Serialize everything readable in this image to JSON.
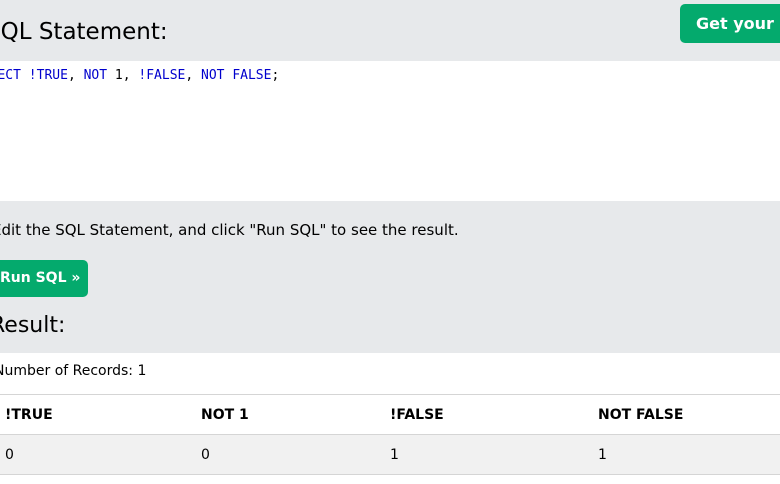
{
  "header": {
    "title": "SQL Statement:",
    "get_own_label": "Get your own"
  },
  "editor": {
    "tokens": [
      {
        "text": "SELECT",
        "kw": true
      },
      {
        "text": " ",
        "kw": false
      },
      {
        "text": "!TRUE",
        "kw": true
      },
      {
        "text": ", ",
        "kw": false
      },
      {
        "text": "NOT",
        "kw": true
      },
      {
        "text": " 1, ",
        "kw": false
      },
      {
        "text": "!FALSE",
        "kw": true
      },
      {
        "text": ", ",
        "kw": false
      },
      {
        "text": "NOT FALSE",
        "kw": true
      },
      {
        "text": ";",
        "kw": false
      }
    ]
  },
  "instruction": "Edit the SQL Statement, and click \"Run SQL\" to see the result.",
  "run_button_label": "Run SQL »",
  "result": {
    "title": "Result:",
    "records_text": "Number of Records: 1",
    "columns": [
      "!TRUE",
      "NOT 1",
      "!FALSE",
      "NOT FALSE"
    ],
    "rows": [
      [
        "0",
        "0",
        "1",
        "1"
      ]
    ]
  },
  "colors": {
    "accent": "#04aa6d",
    "keyword": "#0000cd",
    "background": "#e7e9eb"
  }
}
